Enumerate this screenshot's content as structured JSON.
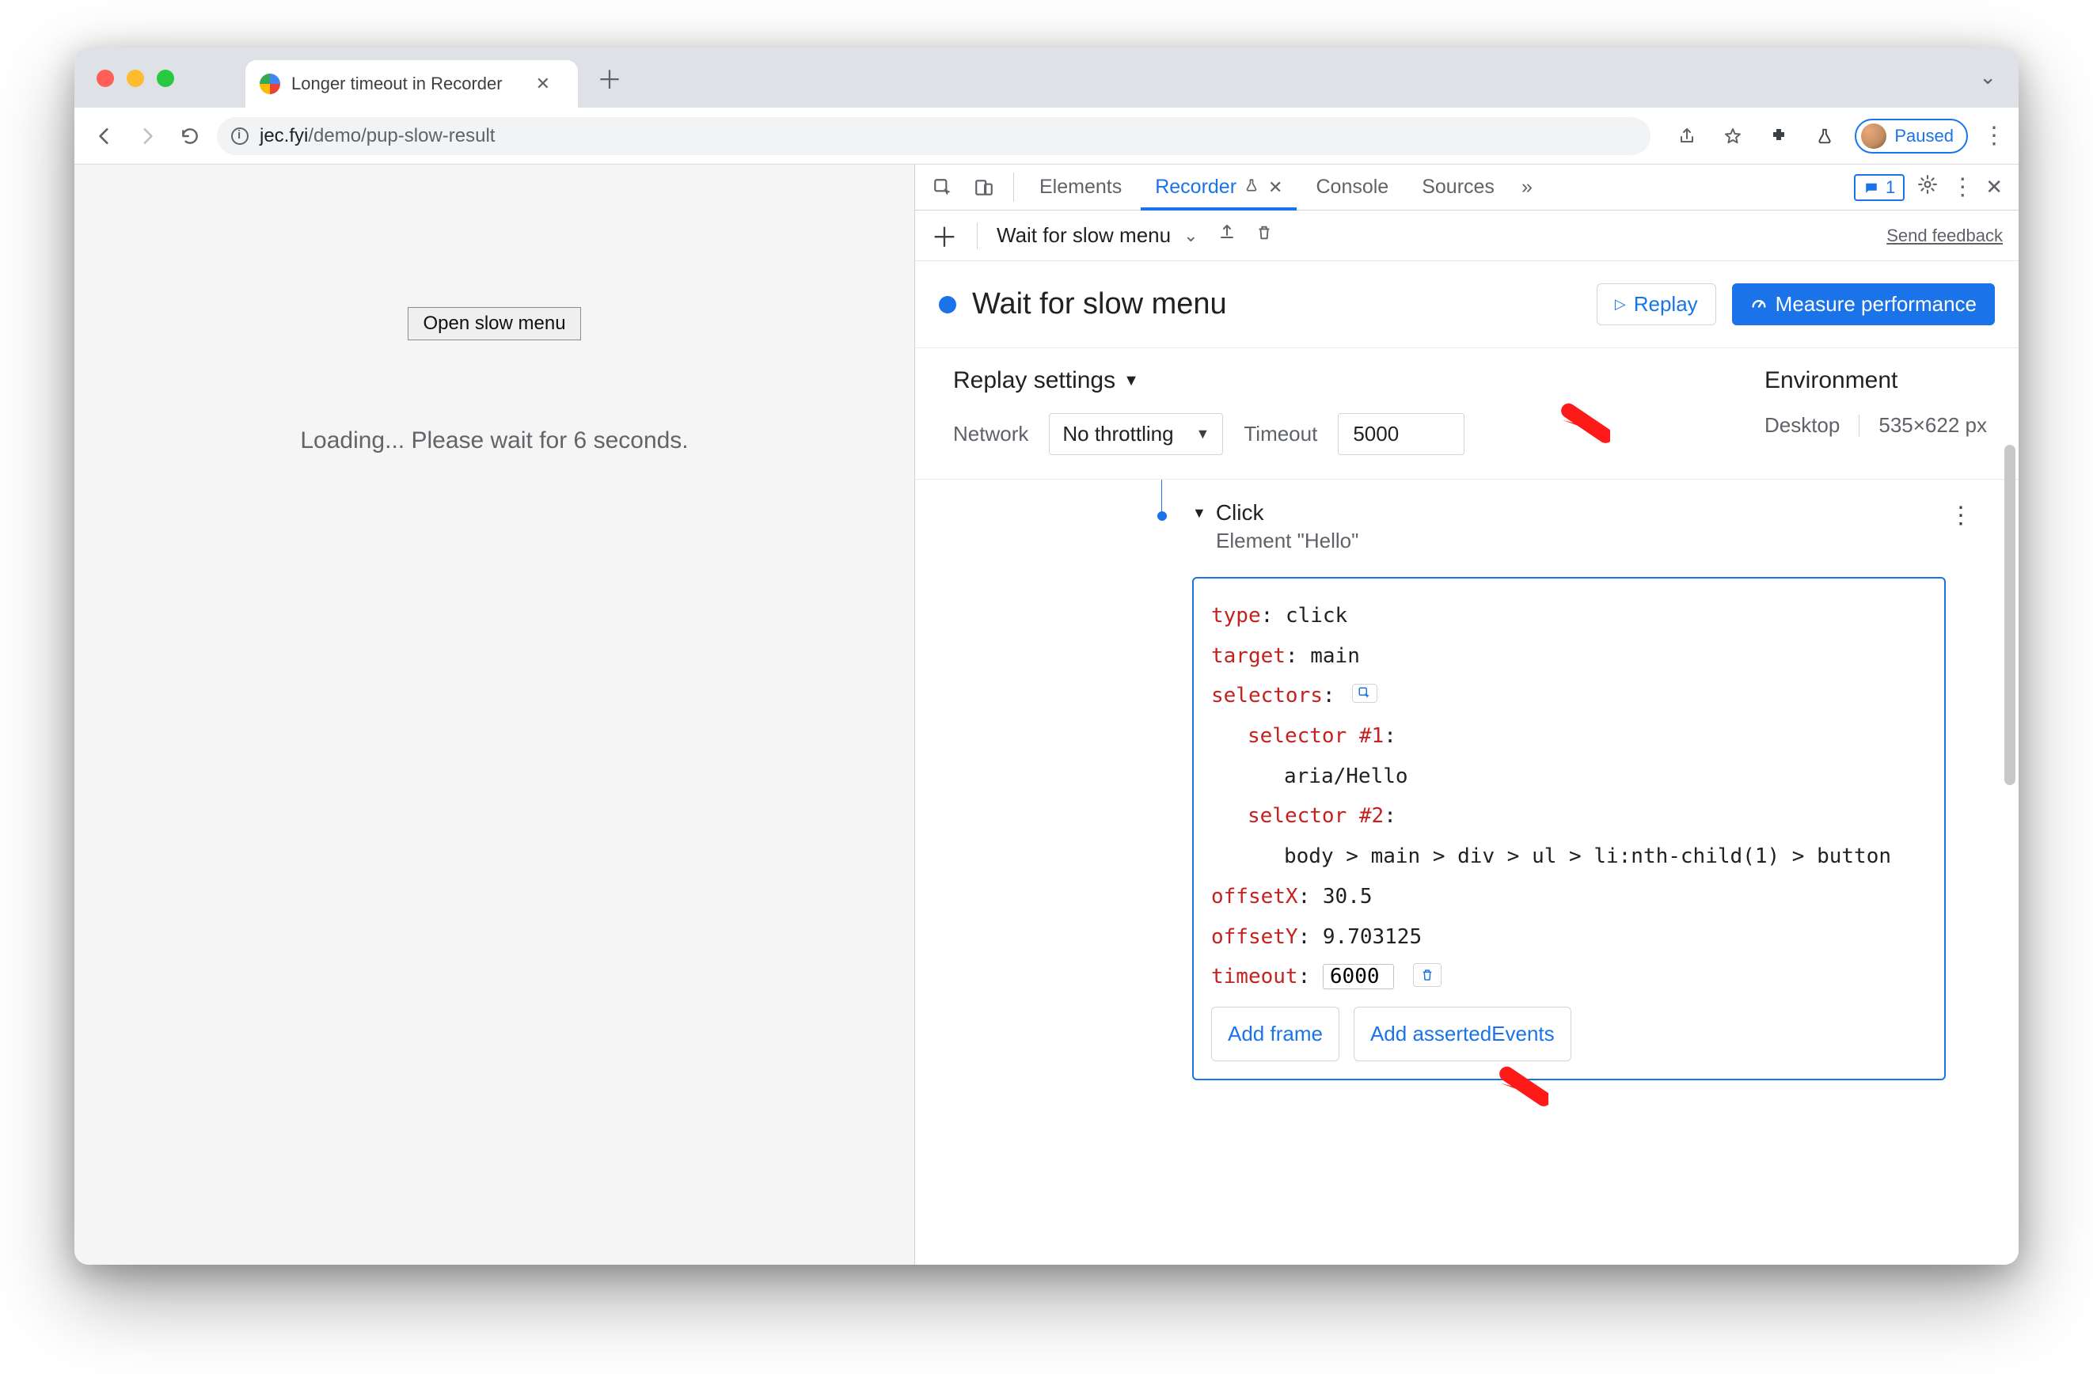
{
  "browser": {
    "tab_title": "Longer timeout in Recorder",
    "url_host": "jec.fyi",
    "url_path": "/demo/pup-slow-result",
    "profile_state": "Paused"
  },
  "page": {
    "button_label": "Open slow menu",
    "loading_text": "Loading... Please wait for 6 seconds."
  },
  "devtools": {
    "tabs": {
      "elements": "Elements",
      "recorder": "Recorder",
      "console": "Console",
      "sources": "Sources"
    },
    "issue_count": "1",
    "recorder_bar": {
      "recording_name": "Wait for slow menu",
      "send_feedback": "Send feedback"
    },
    "rec_header": {
      "title": "Wait for slow menu",
      "replay": "Replay",
      "measure": "Measure performance"
    },
    "settings": {
      "header": "Replay settings",
      "network_label": "Network",
      "network_value": "No throttling",
      "timeout_label": "Timeout",
      "timeout_value": "5000",
      "env_header": "Environment",
      "env_device": "Desktop",
      "env_size": "535×622 px"
    },
    "step": {
      "title": "Click",
      "subtitle": "Element \"Hello\"",
      "type_k": "type",
      "type_v": "click",
      "target_k": "target",
      "target_v": "main",
      "selectors_k": "selectors",
      "sel1_k": "selector #1",
      "sel1_v": "aria/Hello",
      "sel2_k": "selector #2",
      "sel2_v": "body > main > div > ul > li:nth-child(1) > button",
      "offx_k": "offsetX",
      "offx_v": "30.5",
      "offy_k": "offsetY",
      "offy_v": "9.703125",
      "timeout_k": "timeout",
      "timeout_v": "6000",
      "add_frame": "Add frame",
      "add_asserted": "Add assertedEvents"
    }
  }
}
